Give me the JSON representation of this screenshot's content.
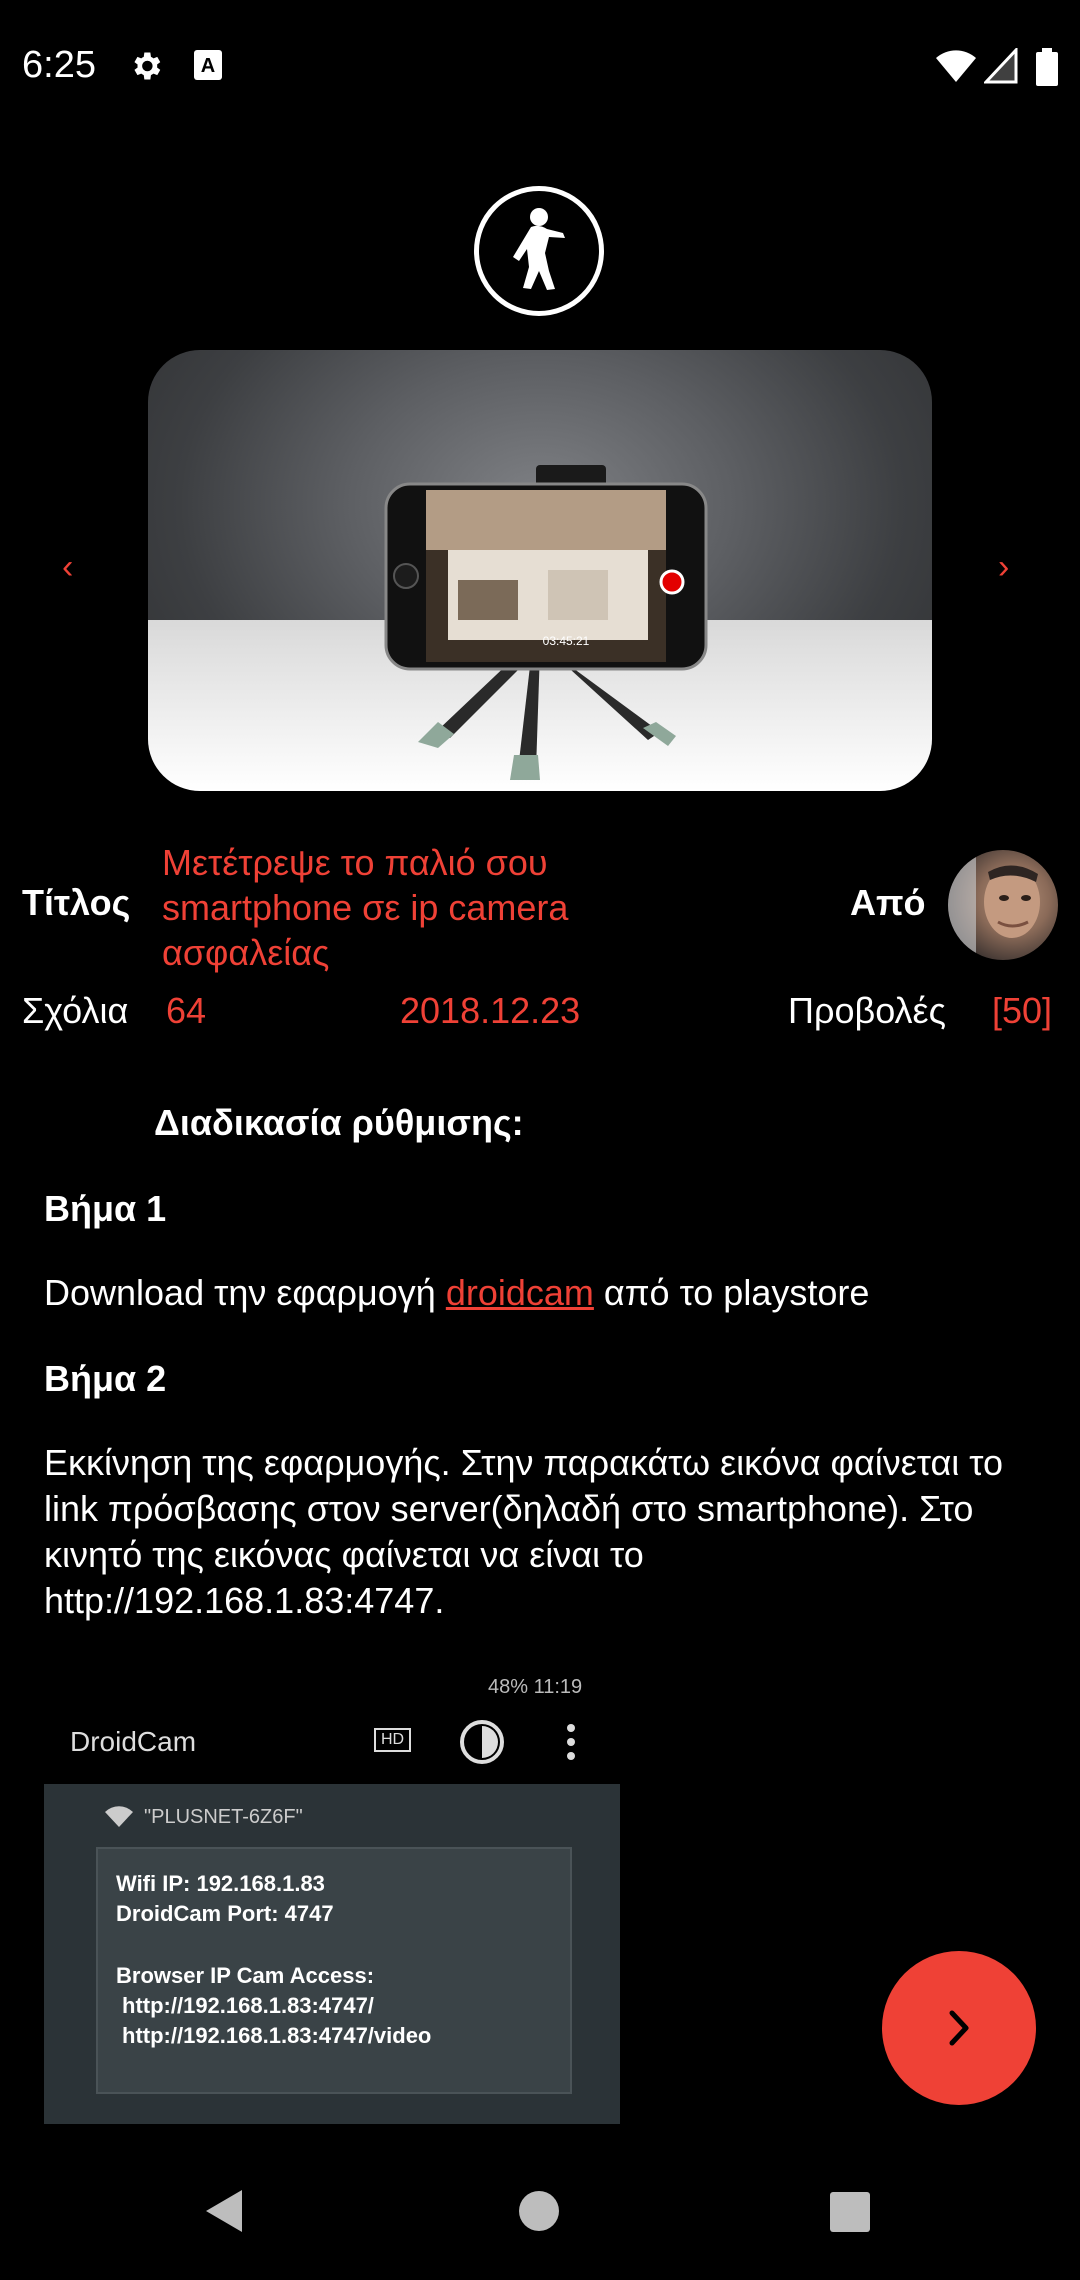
{
  "status": {
    "time": "6:25"
  },
  "hero": {
    "prev_symbol": "‹",
    "next_symbol": "›"
  },
  "meta": {
    "title_label": "Τίτλος",
    "title_value": "Μετέτρεψε το παλιό σου smartphone σε ip camera ασφαλείας",
    "author_label": "Από",
    "comments_label": "Σχόλια",
    "comments_count": "64",
    "date": "2018.12.23",
    "views_label": "Προβολές",
    "views_count": "[50]"
  },
  "article": {
    "heading": "Διαδικασία ρύθμισης:",
    "step1_title": "Βήμα 1",
    "step1_text_before": "Download την εφαρμογή ",
    "step1_link": "droidcam",
    "step1_text_after": " από το playstore",
    "step2_title": "Βήμα 2",
    "step2_text": "Εκκίνηση της εφαρμογής. Στην παρακάτω εικόνα φαίνεται το link πρόσβασης στον server(δηλαδή στο smartphone). Στο κινητό της εικόνας φαίνεται να είναι το http://192.168.1.83:4747."
  },
  "screenshot": {
    "status_text": "48% 11:19",
    "app_title": "DroidCam",
    "wifi_name": "\"PLUSNET-6Z6F\"",
    "wifi_ip": "Wifi IP: 192.168.1.83",
    "port": "DroidCam Port: 4747",
    "browser_access": "Browser IP Cam Access:",
    "url1": "http://192.168.1.83:4747/",
    "url2": "http://192.168.1.83:4747/video",
    "hd_badge": "HD"
  },
  "colors": {
    "accent": "#ef4136",
    "background": "#000000"
  },
  "icons": [
    "gear-icon",
    "a-keyboard-icon",
    "wifi-icon",
    "signal-icon",
    "battery-icon",
    "zombie-logo-icon",
    "chevron-left-icon",
    "chevron-right-icon",
    "fab-chevron-right-icon",
    "nav-back-icon",
    "nav-home-icon",
    "nav-recents-icon"
  ]
}
